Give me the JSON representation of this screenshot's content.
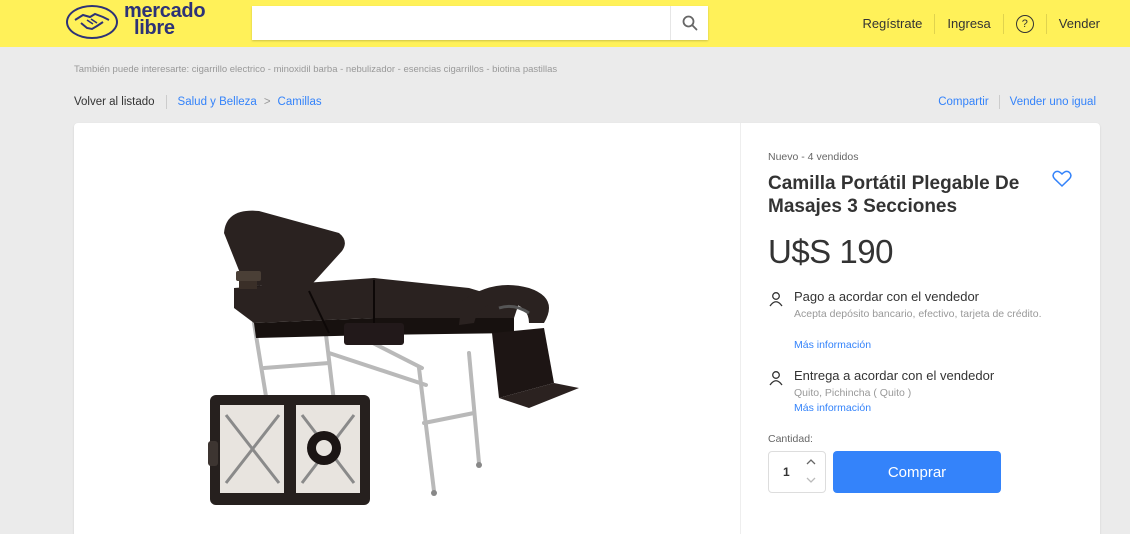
{
  "brand": {
    "line1": "mercado",
    "line2": "libre"
  },
  "search": {
    "placeholder": "",
    "value": ""
  },
  "nav": {
    "register": "Regístrate",
    "login": "Ingresa",
    "help": "?",
    "sell": "Vender"
  },
  "suggestions": {
    "text": "También puede interesarte: cigarrillo electrico - minoxidil barba - nebulizador - esencias cigarrillos - biotina pastillas"
  },
  "breadcrumb": {
    "back": "Volver al listado",
    "items": [
      "Salud y Belleza",
      "Camillas"
    ],
    "separator": ">"
  },
  "actions": {
    "share": "Compartir",
    "sell_same": "Vender uno igual"
  },
  "product": {
    "condition": "Nuevo  -  4 vendidos",
    "title": "Camilla Portátil Plegable De Masajes 3 Secciones",
    "price": "U$S 190",
    "payment": {
      "title": "Pago a acordar con el vendedor",
      "desc": "Acepta depósito bancario, efectivo, tarjeta de crédito.",
      "more": "Más información"
    },
    "delivery": {
      "title": "Entrega a acordar con el vendedor",
      "desc": "Quito, Pichincha ( Quito )",
      "more": "Más información"
    },
    "quantity_label": "Cantidad:",
    "quantity": "1",
    "buy": "Comprar"
  },
  "colors": {
    "header": "#fff159",
    "brand": "#2d3277",
    "accent": "#3483fa"
  },
  "icons": [
    "handshake-icon",
    "search-icon",
    "help-icon",
    "heart-icon",
    "person-icon",
    "chevron-up-icon",
    "chevron-down-icon"
  ]
}
